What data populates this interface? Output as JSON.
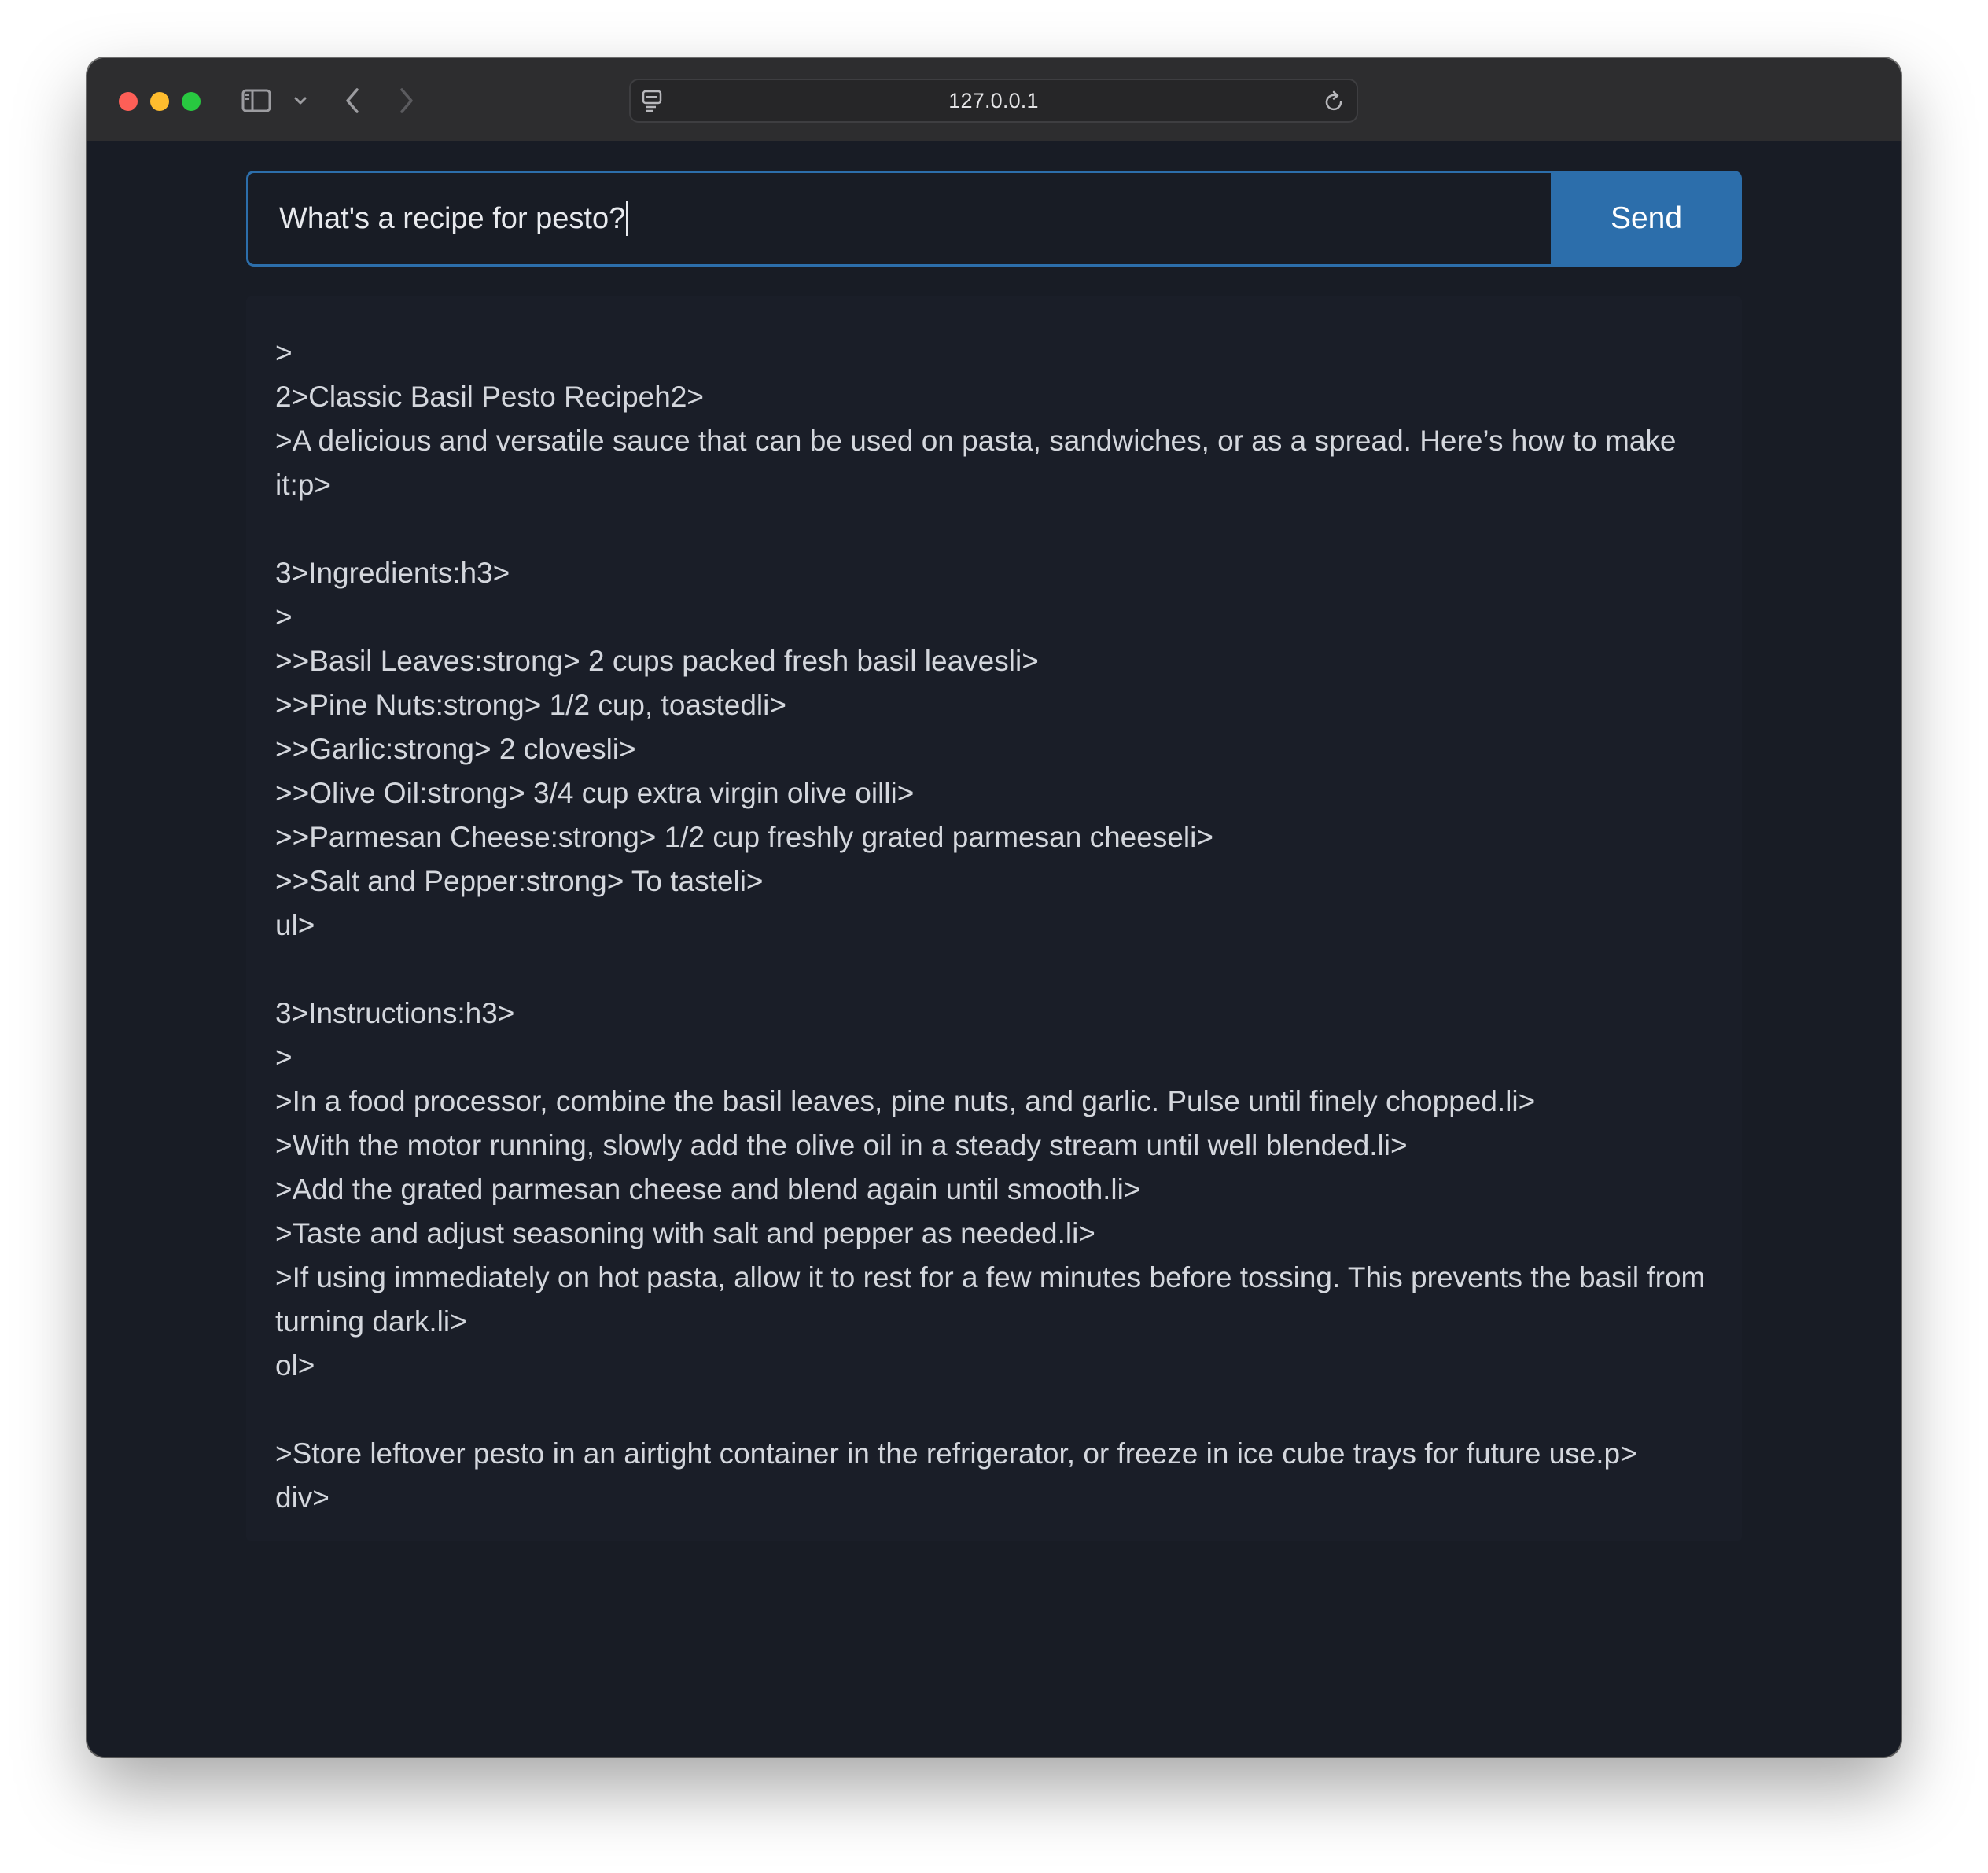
{
  "browser": {
    "url": "127.0.0.1",
    "icons": {
      "sidebar": "sidebar-icon",
      "chevron": "chevron-down-icon",
      "back": "back-arrow-icon",
      "forward": "forward-arrow-icon",
      "page": "page-menu-icon",
      "reload": "reload-icon"
    }
  },
  "chat": {
    "input_value": "What's a recipe for pesto?",
    "send_label": "Send",
    "accent_color": "#2c6eab"
  },
  "response": {
    "lines": [
      ">",
      "2>Classic Basil Pesto Recipeh2>",
      ">A delicious and versatile sauce that can be used on pasta, sandwiches, or as a spread. Here’s how to make it:p>",
      "",
      "3>Ingredients:h3>",
      ">",
      ">>Basil Leaves:strong> 2 cups packed fresh basil leavesli>",
      ">>Pine Nuts:strong> 1/2 cup, toastedli>",
      ">>Garlic:strong> 2 clovesli>",
      ">>Olive Oil:strong> 3/4 cup extra virgin olive oilli>",
      ">>Parmesan Cheese:strong> 1/2 cup freshly grated parmesan cheeseli>",
      ">>Salt and Pepper:strong> To tasteli>",
      "ul>",
      "",
      "3>Instructions:h3>",
      ">",
      ">In a food processor, combine the basil leaves, pine nuts, and garlic. Pulse until finely chopped.li>",
      ">With the motor running, slowly add the olive oil in a steady stream until well blended.li>",
      ">Add the grated parmesan cheese and blend again until smooth.li>",
      ">Taste and adjust seasoning with salt and pepper as needed.li>",
      ">If using immediately on hot pasta, allow it to rest for a few minutes before tossing. This prevents the basil from turning dark.li>",
      "ol>",
      "",
      ">Store leftover pesto in an airtight container in the refrigerator, or freeze in ice cube trays for future use.p>",
      "div>"
    ]
  }
}
